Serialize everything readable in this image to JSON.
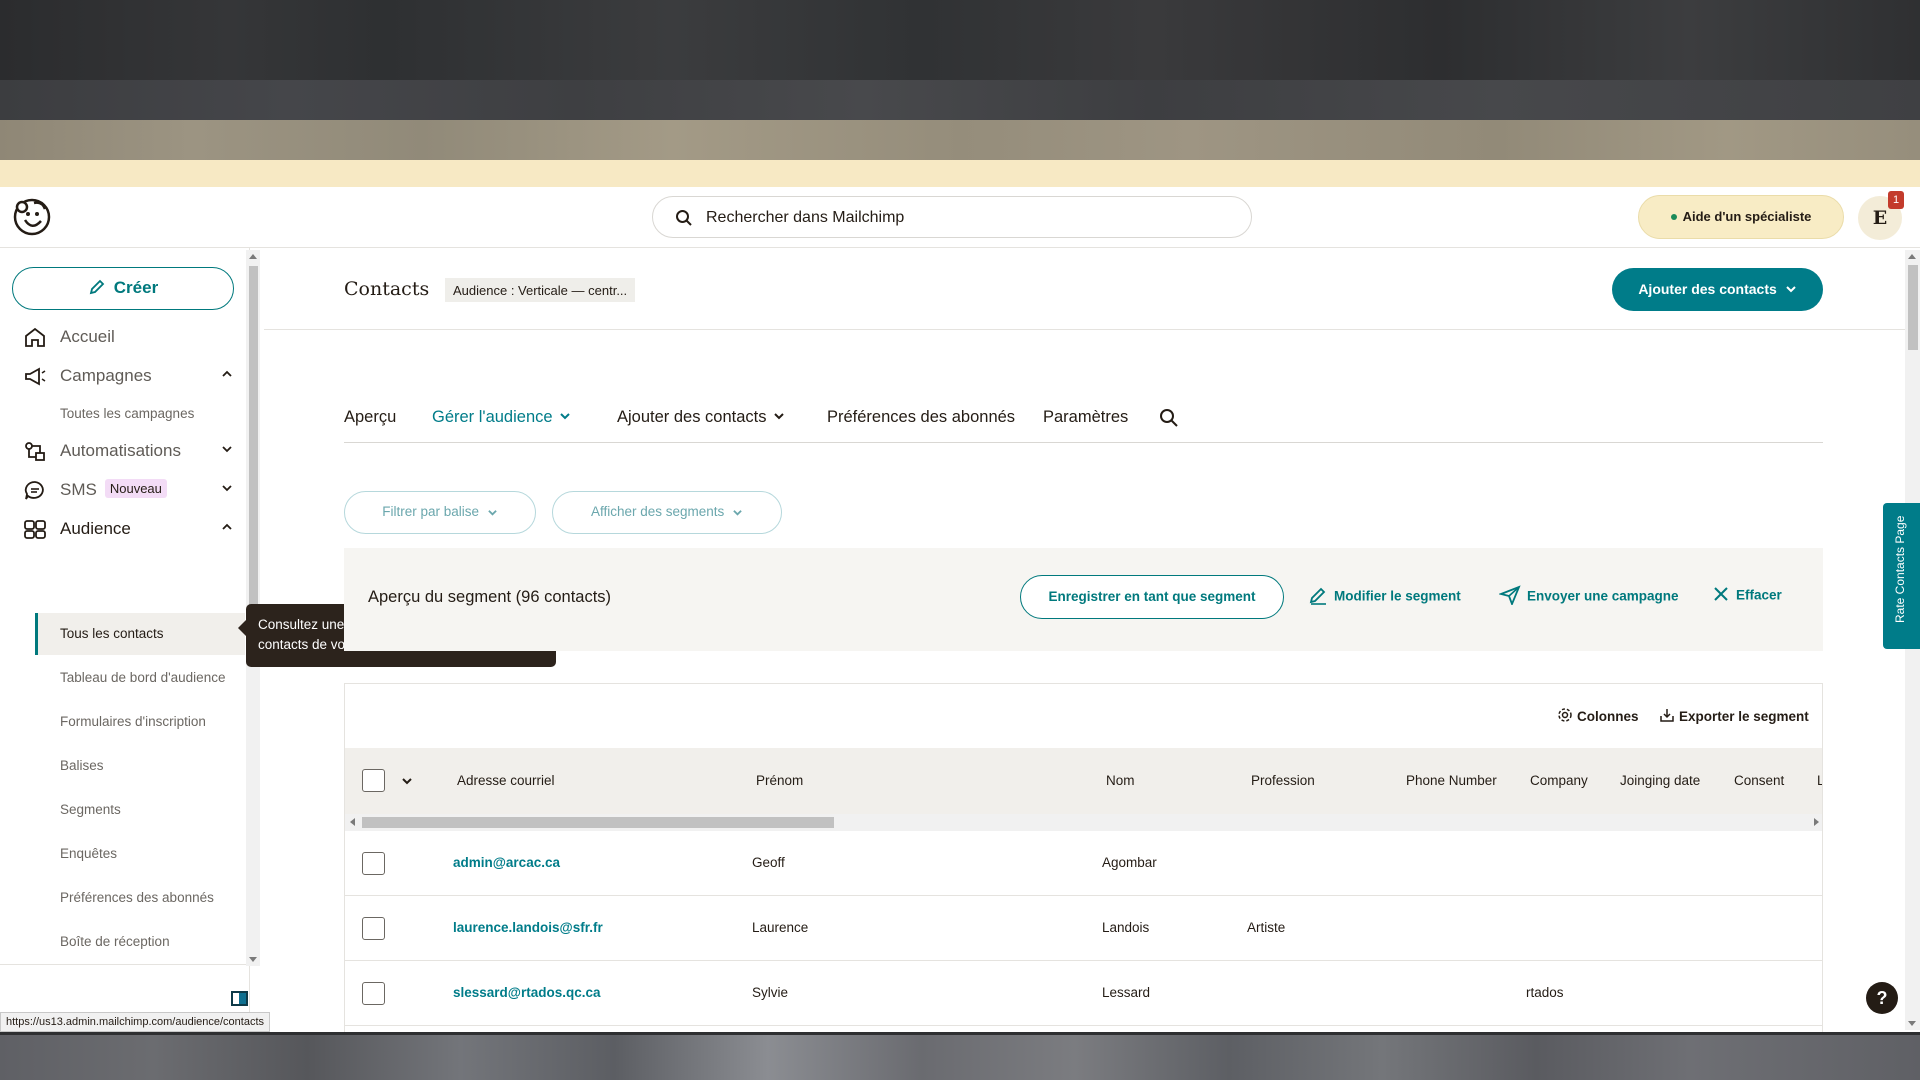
{
  "topbar": {
    "search_placeholder": "Rechercher dans Mailchimp",
    "help_label": "Aide d'un spécialiste",
    "avatar_initial": "E",
    "notification_count": "1"
  },
  "sidebar": {
    "create_label": "Créer",
    "items": [
      {
        "label": "Accueil",
        "icon": "home-icon"
      },
      {
        "label": "Campagnes",
        "icon": "megaphone-icon",
        "expanded": true
      },
      {
        "label": "Automatisations",
        "icon": "automation-icon",
        "expanded": false
      },
      {
        "label": "SMS",
        "icon": "sms-icon",
        "badge": "Nouveau",
        "expanded": false
      },
      {
        "label": "Audience",
        "icon": "audience-icon",
        "expanded": true
      }
    ],
    "campaign_sub": [
      "Toutes les campagnes"
    ],
    "audience_sub": [
      "Tous les contacts",
      "Tableau de bord d'audience",
      "Formulaires d'inscription",
      "Balises",
      "Segments",
      "Enquêtes",
      "Préférences des abonnés",
      "Boîte de réception"
    ],
    "active_item": "Tous les contacts"
  },
  "tooltip": "Consultez une liste regroupant tous les contacts de votre audience.",
  "header": {
    "title": "Contacts",
    "audience_pill": "Audience : Verticale — centr...",
    "add_contacts_label": "Ajouter des contacts"
  },
  "tabs": [
    {
      "label": "Aperçu",
      "dropdown": false
    },
    {
      "label": "Gérer l'audience",
      "dropdown": true,
      "active": true
    },
    {
      "label": "Ajouter des contacts",
      "dropdown": true
    },
    {
      "label": "Préférences des abonnés",
      "dropdown": false
    },
    {
      "label": "Paramètres",
      "dropdown": false
    }
  ],
  "filters": {
    "tag_filter": "Filtrer par balise",
    "segment_filter": "Afficher des segments"
  },
  "segment": {
    "title": "Aperçu du segment (96 contacts)",
    "save_label": "Enregistrer en tant que segment",
    "edit_label": "Modifier le segment",
    "send_label": "Envoyer une campagne",
    "clear_label": "Effacer"
  },
  "table": {
    "columns_label": "Colonnes",
    "export_label": "Exporter le segment",
    "headers": [
      "Adresse courriel",
      "Prénom",
      "Nom",
      "Profession",
      "Phone Number",
      "Company",
      "Joinging date",
      "Consent",
      "L"
    ],
    "rows": [
      {
        "email": "admin@arcac.ca",
        "first": "Geoff",
        "last": "Agombar",
        "profession": "",
        "company": ""
      },
      {
        "email": "laurence.landois@sfr.fr",
        "first": "Laurence",
        "last": "Landois",
        "profession": "Artiste",
        "company": ""
      },
      {
        "email": "slessard@rtados.qc.ca",
        "first": "Sylvie",
        "last": "Lessard",
        "profession": "",
        "company": "rtados"
      }
    ]
  },
  "rate_tab": "Rate Contacts Page",
  "status_url": "https://us13.admin.mailchimp.com/audience/contacts",
  "colors": {
    "accent": "#007c89",
    "tooltip_bg": "#2c231c",
    "help_bg": "#f8ecc5"
  }
}
